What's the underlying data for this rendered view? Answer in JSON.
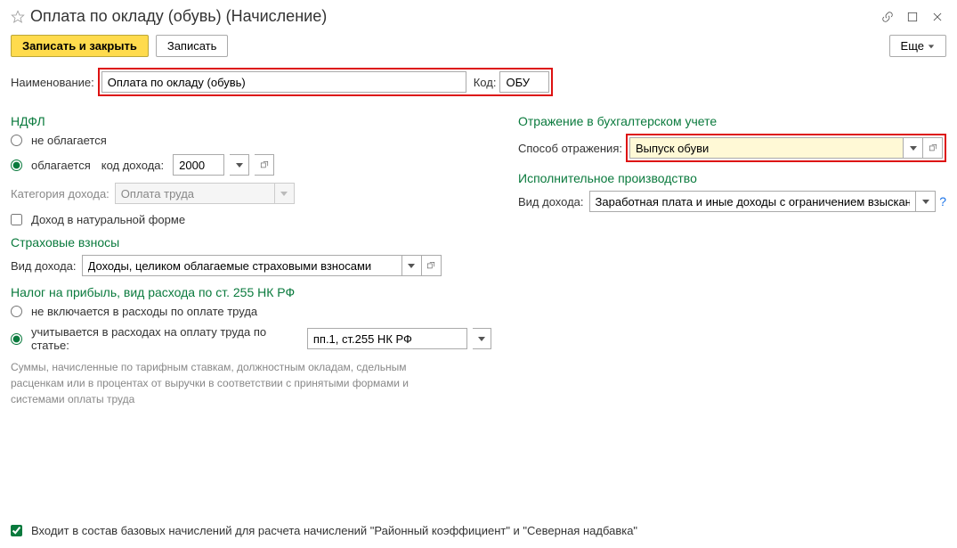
{
  "header": {
    "title": "Оплата по окладу (обувь) (Начисление)"
  },
  "toolbar": {
    "save_close": "Записать и закрыть",
    "save": "Записать",
    "more": "Еще"
  },
  "name_row": {
    "label": "Наименование:",
    "value": "Оплата по окладу (обувь)",
    "code_label": "Код:",
    "code_value": "ОБУ"
  },
  "ndfl": {
    "title": "НДФЛ",
    "not_taxed": "не облагается",
    "taxed": "облагается",
    "income_code_label": "код дохода:",
    "income_code_value": "2000",
    "category_label": "Категория дохода:",
    "category_value": "Оплата труда",
    "in_kind": "Доход в натуральной форме"
  },
  "insurance": {
    "title": "Страховые взносы",
    "type_label": "Вид дохода:",
    "type_value": "Доходы, целиком облагаемые страховыми взносами"
  },
  "profit_tax": {
    "title": "Налог на прибыль, вид расхода по ст. 255 НК РФ",
    "not_included": "не включается в расходы по оплате труда",
    "included": "учитывается в расходах на оплату труда по статье:",
    "article_value": "пп.1, ст.255 НК РФ",
    "note": "Суммы, начисленные по тарифным ставкам, должностным окладам, сдельным расценкам или в процентах от выручки в соответствии с принятыми формами и системами оплаты труда"
  },
  "accounting": {
    "title": "Отражение в бухгалтерском учете",
    "method_label": "Способ отражения:",
    "method_value": "Выпуск обуви"
  },
  "executive": {
    "title": "Исполнительное производство",
    "type_label": "Вид дохода:",
    "type_value": "Заработная плата и иные доходы с ограничением взыскан"
  },
  "footer": {
    "base_accruals": "Входит в состав базовых начислений для расчета начислений \"Районный коэффициент\" и \"Северная надбавка\""
  }
}
